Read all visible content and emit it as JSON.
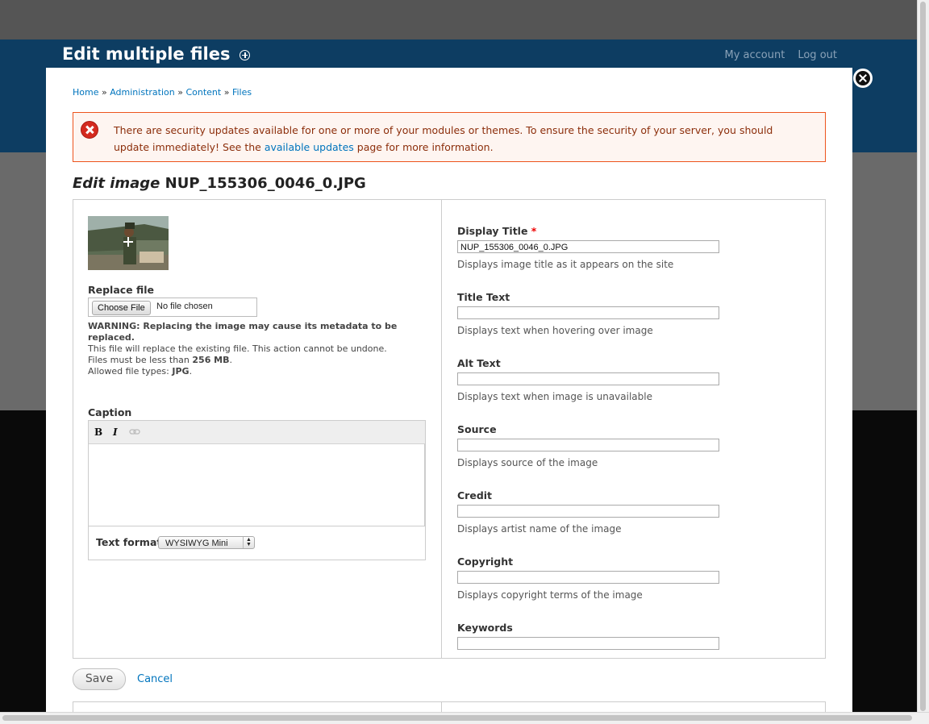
{
  "page": {
    "title": "Edit multiple files",
    "top_links": [
      "My account",
      "Log out"
    ]
  },
  "breadcrumb": {
    "items": [
      "Home",
      "Administration",
      "Content",
      "Files"
    ],
    "separator": "»"
  },
  "alert": {
    "text_before": "There are security updates available for one or more of your modules or themes. To ensure the security of your server, you should update immediately! See the ",
    "link": "available updates",
    "text_after": " page for more information."
  },
  "edit": {
    "heading_prefix": "Edit image",
    "filename": "NUP_155306_0046_0.JPG"
  },
  "left": {
    "replace_label": "Replace file",
    "choose_button": "Choose File",
    "no_file": "No file chosen",
    "warning_bold": "WARNING: Replacing the image may cause its metadata to be replaced.",
    "warning_line1": "This file will replace the existing file. This action cannot be undone.",
    "size_prefix": "Files must be less than ",
    "size_value": "256 MB",
    "size_suffix": ".",
    "types_prefix": "Allowed file types: ",
    "types_value": "JPG",
    "types_suffix": ".",
    "caption_label": "Caption",
    "toolbar": {
      "bold": "B",
      "italic": "I"
    },
    "text_format_label": "Text format",
    "text_format_value": "WYSIWYG Mini"
  },
  "fields": {
    "display_title": {
      "label": "Display Title",
      "required": "*",
      "value": "NUP_155306_0046_0.JPG",
      "desc": "Displays image title as it appears on the site"
    },
    "title_text": {
      "label": "Title Text",
      "value": "",
      "desc": "Displays text when hovering over image"
    },
    "alt_text": {
      "label": "Alt Text",
      "value": "",
      "desc": "Displays text when image is unavailable"
    },
    "source": {
      "label": "Source",
      "value": "",
      "desc": "Displays source of the image"
    },
    "credit": {
      "label": "Credit",
      "value": "",
      "desc": "Displays artist name of the image"
    },
    "copyright": {
      "label": "Copyright",
      "value": "",
      "desc": "Displays copyright terms of the image"
    },
    "keywords": {
      "label": "Keywords",
      "value": ""
    }
  },
  "actions": {
    "save": "Save",
    "cancel": "Cancel"
  },
  "colors": {
    "header_blue": "#0d3d62",
    "link": "#0074bd",
    "alert_border": "#ed541d",
    "alert_text": "#8c2e0b"
  }
}
